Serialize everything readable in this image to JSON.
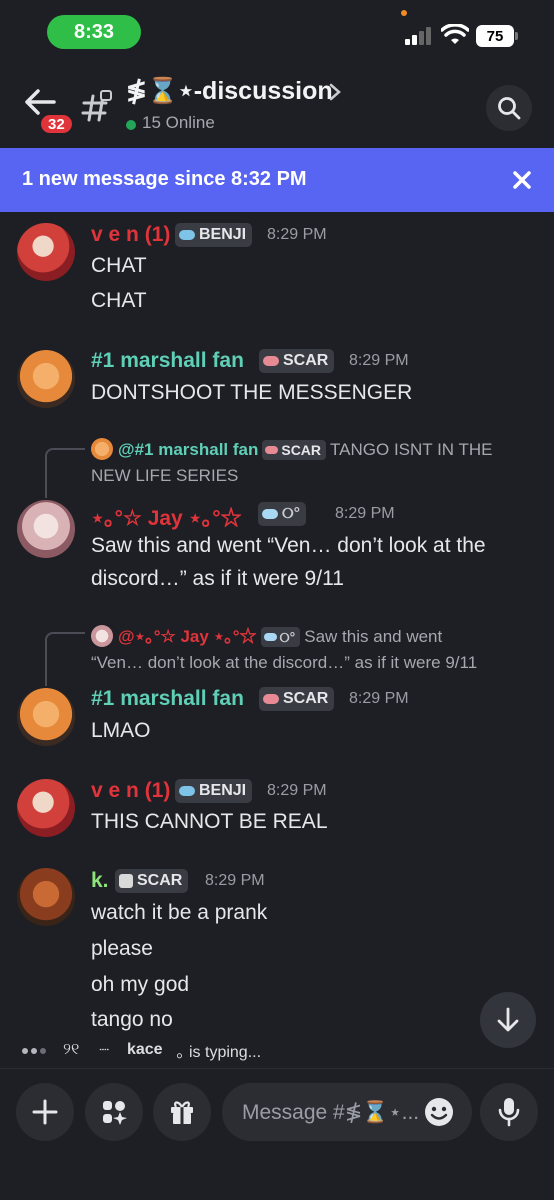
{
  "status_bar": {
    "time": "8:33",
    "battery": "75"
  },
  "header": {
    "title": "≸⌛⋆-discussion",
    "online": "15 Online",
    "back_badge": "32"
  },
  "banner": {
    "text": "1 new message since 8:32 PM"
  },
  "messages": [
    {
      "author": "v e n (1)",
      "tag": "BENJI",
      "time": "8:29 PM",
      "lines": [
        "CHAT",
        "CHAT"
      ]
    },
    {
      "author": "#1 marshall fan",
      "tag": "SCAR",
      "time": "8:29 PM",
      "lines": [
        "DONTSHOOT THE MESSENGER"
      ]
    },
    {
      "reply": {
        "author": "@#1 marshall fan",
        "tag": "SCAR",
        "text_1": "TANGO ISNT IN THE",
        "text_2": "NEW LIFE SERIES"
      },
      "author": "⋆｡°☆ Jay ⋆｡°☆",
      "time": "8:29 PM",
      "lines": [
        "Saw this and went “Ven… don’t look at the",
        "discord…” as if it were 9/11"
      ]
    },
    {
      "reply": {
        "author": "@⋆｡°☆ Jay ⋆｡°☆",
        "text_1": "Saw this and went",
        "text_2": "“Ven… don’t look at the discord…” as if it were 9/11"
      },
      "author": "#1 marshall fan",
      "tag": "SCAR",
      "time": "8:29 PM",
      "lines": [
        "LMAO"
      ]
    },
    {
      "author": "v e n (1)",
      "tag": "BENJI",
      "time": "8:29 PM",
      "lines": [
        "THIS CANNOT BE REAL"
      ]
    },
    {
      "author": "k.",
      "tag": "SCAR",
      "time": "8:29 PM",
      "lines": [
        "watch it be a prank",
        "please",
        "oh my god",
        "tango no"
      ]
    }
  ],
  "typing": {
    "glyphs": "୨୧",
    "dash": "┈",
    "user": "kace",
    "suffix": "｡ is typing..."
  },
  "composer": {
    "placeholder": "Message #≸⌛⋆..."
  },
  "colors": {
    "accent": "#5865f2",
    "ven": "#e0343b",
    "marshall": "#5fcfb6",
    "jay": "#e0343b",
    "k": "#8ee37a",
    "online": "#23a55a",
    "badge": "#e0343b"
  },
  "icons": [
    "back-arrow-icon",
    "locked-hash-icon",
    "chevron-right-icon",
    "search-icon",
    "close-icon",
    "arrow-down-icon",
    "plus-icon",
    "apps-icon",
    "gift-icon",
    "emoji-icon",
    "microphone-icon"
  ]
}
